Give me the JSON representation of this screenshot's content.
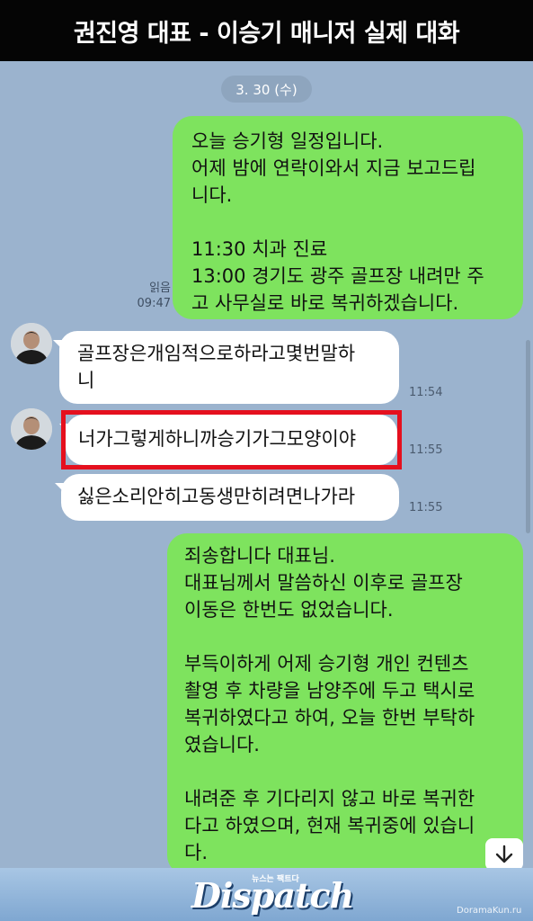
{
  "headline": "권진영 대표 - 이승기 매니저 실제 대화",
  "chat": {
    "date_label": "3. 30 (수)",
    "read_label": "읽음",
    "messages": [
      {
        "sender": "me",
        "text": "오늘 승기형 일정입니다.\n어제 밤에 연락이와서 지금 보고드립\n니다.\n\n11:30 치과 진료\n13:00 경기도 광주 골프장 내려만 주\n고 사무실로 바로 복귀하겠습니다.",
        "time": "09:47"
      },
      {
        "sender": "other",
        "text": "골프장은개임적으로하라고몇번말하\n니",
        "time": "11:54"
      },
      {
        "sender": "other",
        "text": "너가그렇게하니까승기가그모양이야",
        "time": "11:55",
        "highlighted": true
      },
      {
        "sender": "other",
        "text": "싫은소리안히고동생만히려면나가라",
        "time": "11:55"
      },
      {
        "sender": "me",
        "text": "죄송합니다 대표님.\n대표님께서 말씀하신 이후로 골프장\n이동은 한번도 없었습니다.\n\n부득이하게 어제 승기형 개인 컨텐츠\n촬영 후 차량을 남양주에 두고 택시로\n복귀하였다고 하여, 오늘 한번 부탁하\n였습니다.\n\n내려준 후 기다리지 않고 바로 복귀한\n다고 하였으며, 현재 복귀중에 있습니\n다."
      }
    ],
    "icons": {
      "avatar": "avatar-icon",
      "scroll_down": "arrow-down-icon"
    }
  },
  "footer": {
    "brand": "Dispatch",
    "brand_tag": "뉴스는 팩트다",
    "watermark": "DoramaKun.ru"
  },
  "colors": {
    "header_bg": "#050505",
    "chat_bg": "#9bb3ce",
    "outgoing_bubble": "#7ee35e",
    "incoming_bubble": "#ffffff",
    "highlight": "#e5101e"
  }
}
